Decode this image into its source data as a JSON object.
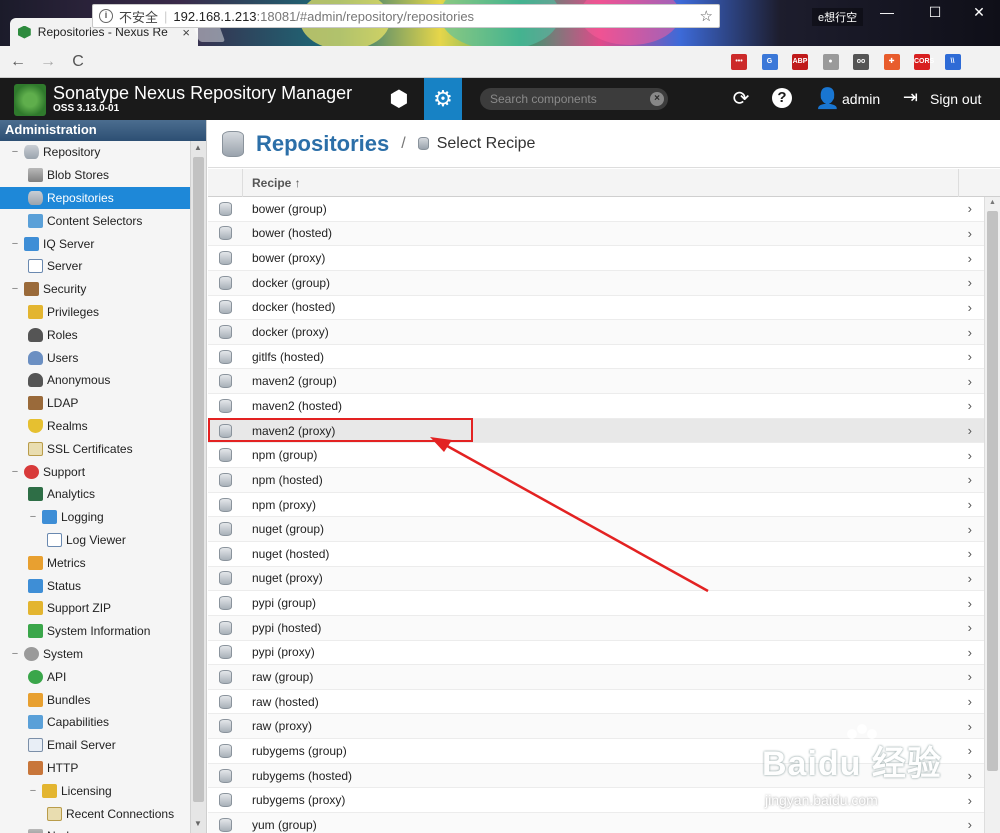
{
  "browser": {
    "tab_title": "Repositories - Nexus Re",
    "tab_close": "×",
    "user_badge": "e想行空",
    "window_controls": [
      "—",
      "☐",
      "✕"
    ],
    "back": "←",
    "forward": "→",
    "reload": "C",
    "info_glyph": "i",
    "security_label": "不安全",
    "separator": "|",
    "url_host": "192.168.1.213",
    "url_rest": ":18081/#admin/repository/repositories",
    "bookmark_star": "☆",
    "extensions": [
      {
        "name": "ext-1",
        "color": "#cc2a2a",
        "label": "•••"
      },
      {
        "name": "ext-translate",
        "color": "#3b78d8",
        "label": "G"
      },
      {
        "name": "ext-abp",
        "color": "#c01a1a",
        "label": "ABP"
      },
      {
        "name": "ext-4",
        "color": "#9a9a9a",
        "label": "●"
      },
      {
        "name": "ext-5",
        "color": "#555555",
        "label": "oo"
      },
      {
        "name": "ext-6",
        "color": "#e85c2c",
        "label": "✚"
      },
      {
        "name": "ext-cors",
        "color": "#d82020",
        "label": "CORS"
      },
      {
        "name": "ext-8",
        "color": "#2e6bd6",
        "label": "\\\\"
      }
    ]
  },
  "header": {
    "app_title": "Sonatype Nexus Repository Manager",
    "version": "OSS 3.13.0-01",
    "browse_glyph": "⬢",
    "admin_glyph": "⚙",
    "search_placeholder": "Search components",
    "search_clear": "×",
    "refresh_glyph": "⟳",
    "help_glyph": "?",
    "user_glyph": "👤",
    "user": "admin",
    "signout_glyph": "⇥",
    "signout": "Sign out"
  },
  "sidebar": {
    "title": "Administration",
    "items": [
      {
        "label": "Repository",
        "level": 0,
        "toggle": "−",
        "icon": "i-db",
        "icon_name": "database-icon"
      },
      {
        "label": "Blob Stores",
        "level": 1,
        "icon": "i-server",
        "icon_name": "server-icon"
      },
      {
        "label": "Repositories",
        "level": 1,
        "icon": "i-db",
        "icon_name": "database-icon",
        "selected": true
      },
      {
        "label": "Content Selectors",
        "level": 1,
        "icon": "i-cube",
        "icon_name": "selector-icon"
      },
      {
        "label": "IQ Server",
        "level": 0,
        "toggle": "−",
        "icon": "i-blue",
        "icon_name": "iq-icon"
      },
      {
        "label": "Server",
        "level": 1,
        "icon": "i-doc",
        "icon_name": "page-icon"
      },
      {
        "label": "Security",
        "level": 0,
        "toggle": "−",
        "icon": "i-brown",
        "icon_name": "badge-icon"
      },
      {
        "label": "Privileges",
        "level": 1,
        "icon": "i-yellow",
        "icon_name": "medal-icon"
      },
      {
        "label": "Roles",
        "level": 1,
        "icon": "i-user",
        "icon_name": "role-icon"
      },
      {
        "label": "Users",
        "level": 1,
        "icon": "i-people",
        "icon_name": "users-icon"
      },
      {
        "label": "Anonymous",
        "level": 1,
        "icon": "i-user",
        "icon_name": "anonymous-icon"
      },
      {
        "label": "LDAP",
        "level": 1,
        "icon": "i-brown",
        "icon_name": "book-icon"
      },
      {
        "label": "Realms",
        "level": 1,
        "icon": "i-shield",
        "icon_name": "shield-icon"
      },
      {
        "label": "SSL Certificates",
        "level": 1,
        "icon": "i-cert",
        "icon_name": "certificate-icon"
      },
      {
        "label": "Support",
        "level": 0,
        "toggle": "−",
        "icon": "i-red",
        "icon_name": "lifebuoy-icon"
      },
      {
        "label": "Analytics",
        "level": 1,
        "icon": "i-chart",
        "icon_name": "chart-icon"
      },
      {
        "label": "Logging",
        "level": 1,
        "toggle": "−",
        "icon": "i-blue",
        "icon_name": "log-icon"
      },
      {
        "label": "Log Viewer",
        "level": 2,
        "icon": "i-doc",
        "icon_name": "scroll-icon"
      },
      {
        "label": "Metrics",
        "level": 1,
        "icon": "i-orange",
        "icon_name": "metrics-icon"
      },
      {
        "label": "Status",
        "level": 1,
        "icon": "i-blue",
        "icon_name": "status-icon"
      },
      {
        "label": "Support ZIP",
        "level": 1,
        "icon": "i-yellow",
        "icon_name": "zip-icon"
      },
      {
        "label": "System Information",
        "level": 1,
        "icon": "i-green",
        "icon_name": "globe-icon"
      },
      {
        "label": "System",
        "level": 0,
        "toggle": "−",
        "icon": "i-gear",
        "icon_name": "gear-icon"
      },
      {
        "label": "API",
        "level": 1,
        "icon": "i-api",
        "icon_name": "api-icon"
      },
      {
        "label": "Bundles",
        "level": 1,
        "icon": "i-orange",
        "icon_name": "puzzle-icon"
      },
      {
        "label": "Capabilities",
        "level": 1,
        "icon": "i-cube",
        "icon_name": "cube-icon"
      },
      {
        "label": "Email Server",
        "level": 1,
        "icon": "i-mail",
        "icon_name": "mail-icon"
      },
      {
        "label": "HTTP",
        "level": 1,
        "icon": "i-truck",
        "icon_name": "truck-icon"
      },
      {
        "label": "Licensing",
        "level": 1,
        "toggle": "−",
        "icon": "i-yellow",
        "icon_name": "license-icon"
      },
      {
        "label": "Recent Connections",
        "level": 2,
        "icon": "i-cert",
        "icon_name": "connections-icon"
      },
      {
        "label": "Nodes",
        "level": 1,
        "icon": "i-server",
        "icon_name": "nodes-icon"
      }
    ],
    "scroll_up": "▲",
    "scroll_down": "▼"
  },
  "main": {
    "title": "Repositories",
    "separator": "/",
    "subtitle": "Select Recipe",
    "column_header": "Recipe ↑",
    "row_arrow": "›",
    "scroll_up": "▲",
    "recipes": [
      "bower (group)",
      "bower (hosted)",
      "bower (proxy)",
      "docker (group)",
      "docker (hosted)",
      "docker (proxy)",
      "gitlfs (hosted)",
      "maven2 (group)",
      "maven2 (hosted)",
      "maven2 (proxy)",
      "npm (group)",
      "npm (hosted)",
      "npm (proxy)",
      "nuget (group)",
      "nuget (hosted)",
      "nuget (proxy)",
      "pypi (group)",
      "pypi (hosted)",
      "pypi (proxy)",
      "raw (group)",
      "raw (hosted)",
      "raw (proxy)",
      "rubygems (group)",
      "rubygems (hosted)",
      "rubygems (proxy)",
      "yum (group)"
    ],
    "hover_index": 9
  },
  "watermark": {
    "text": "Baidu 经验",
    "url": "jingyan.baidu.com"
  },
  "colors": {
    "accent": "#1782c5",
    "selected": "#1e88d8",
    "title_blue": "#2c6fa8",
    "annotation_red": "#e32222"
  }
}
